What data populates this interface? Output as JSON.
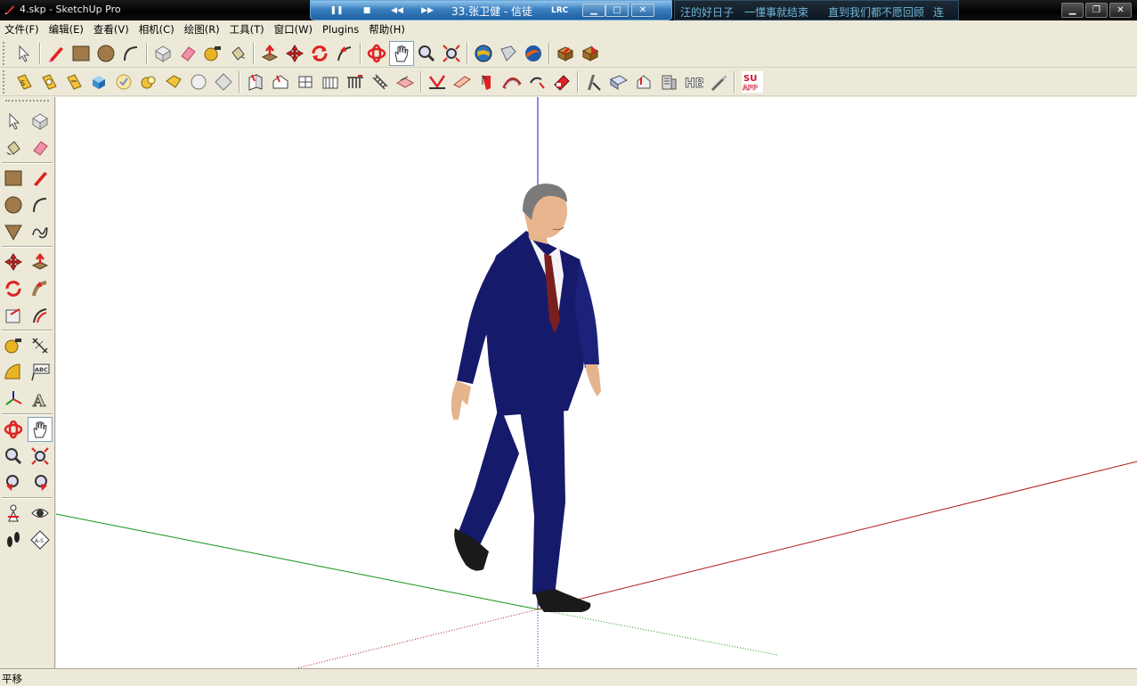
{
  "window": {
    "title": "4.skp - SketchUp Pro",
    "controls": [
      "minimize",
      "maximize",
      "close"
    ]
  },
  "player": {
    "song": "33.张卫健 - 信徒",
    "lrc_label": "LRC",
    "buttons": [
      "pause-icon",
      "stop-icon",
      "prev-icon",
      "next-icon"
    ]
  },
  "lyrics": {
    "lines": [
      "汪的好日子",
      "一懂事就结束",
      "直到我们都不愿回顾",
      "连"
    ]
  },
  "menu": {
    "items": [
      "文件(F)",
      "编辑(E)",
      "查看(V)",
      "相机(C)",
      "绘图(R)",
      "工具(T)",
      "窗口(W)",
      "Plugins",
      "帮助(H)"
    ]
  },
  "toolbar1": {
    "icons": [
      "select-icon",
      "pencil-icon",
      "rectangle-icon",
      "circle-icon",
      "arc-icon",
      "make-component-icon",
      "eraser-icon",
      "tape-measure-icon",
      "paint-bucket-icon",
      "push-pull-icon",
      "move-icon",
      "rotate-icon",
      "follow-me-icon",
      "orbit-icon",
      "pan-icon",
      "zoom-icon",
      "zoom-extents-icon",
      "get-models-icon",
      "share-model-icon",
      "google-earth-icon",
      "component-icon",
      "warehouse-icon"
    ]
  },
  "toolbar2": {
    "icons": [
      "su-tool1-icon",
      "su-tool2-icon",
      "su-tool3-icon",
      "box-icon",
      "check-icon",
      "cloud-icon",
      "tag-icon",
      "sphere-icon",
      "diamond-icon",
      "wall-icon",
      "roof-icon",
      "window-icon",
      "fence-icon",
      "railing-icon",
      "stairs-icon",
      "floor-icon",
      "cut-icon",
      "plank-icon",
      "curve-icon",
      "arch-icon",
      "hook-icon",
      "label-icon",
      "pen-icon",
      "book-icon",
      "house-icon",
      "building-icon",
      "text3d-icon",
      "brush-icon"
    ],
    "su_app_label": "SU APP"
  },
  "lefttoolbar": {
    "rows": [
      [
        "select-icon",
        "make-component-icon"
      ],
      [
        "paint-bucket-icon",
        "eraser-icon"
      ],
      [
        "rectangle-icon",
        "pencil-icon"
      ],
      [
        "circle-icon",
        "arc-icon"
      ],
      [
        "polygon-icon",
        "freehand-icon"
      ],
      [
        "move-icon",
        "push-pull-icon"
      ],
      [
        "rotate-icon",
        "follow-me-icon"
      ],
      [
        "scale-icon",
        "offset-icon"
      ],
      [
        "tape-measure-icon",
        "dimension-icon"
      ],
      [
        "protractor-icon",
        "text-icon"
      ],
      [
        "axes-icon",
        "3d-text-icon"
      ],
      [
        "orbit-icon",
        "pan-icon"
      ],
      [
        "zoom-icon",
        "zoom-window-icon"
      ],
      [
        "previous-view-icon",
        "next-view-icon"
      ],
      [
        "position-camera-icon",
        "look-around-icon"
      ],
      [
        "walk-icon",
        "section-plane-icon"
      ]
    ],
    "labels": {
      "text_tool": "ABC",
      "section": "A-S"
    }
  },
  "status": {
    "text": "平移"
  },
  "colors": {
    "axis_red": "#b01818",
    "axis_green": "#139313",
    "axis_blue": "#1f1fa8",
    "suit": "#161a6a",
    "tie": "#7a1f1f"
  }
}
